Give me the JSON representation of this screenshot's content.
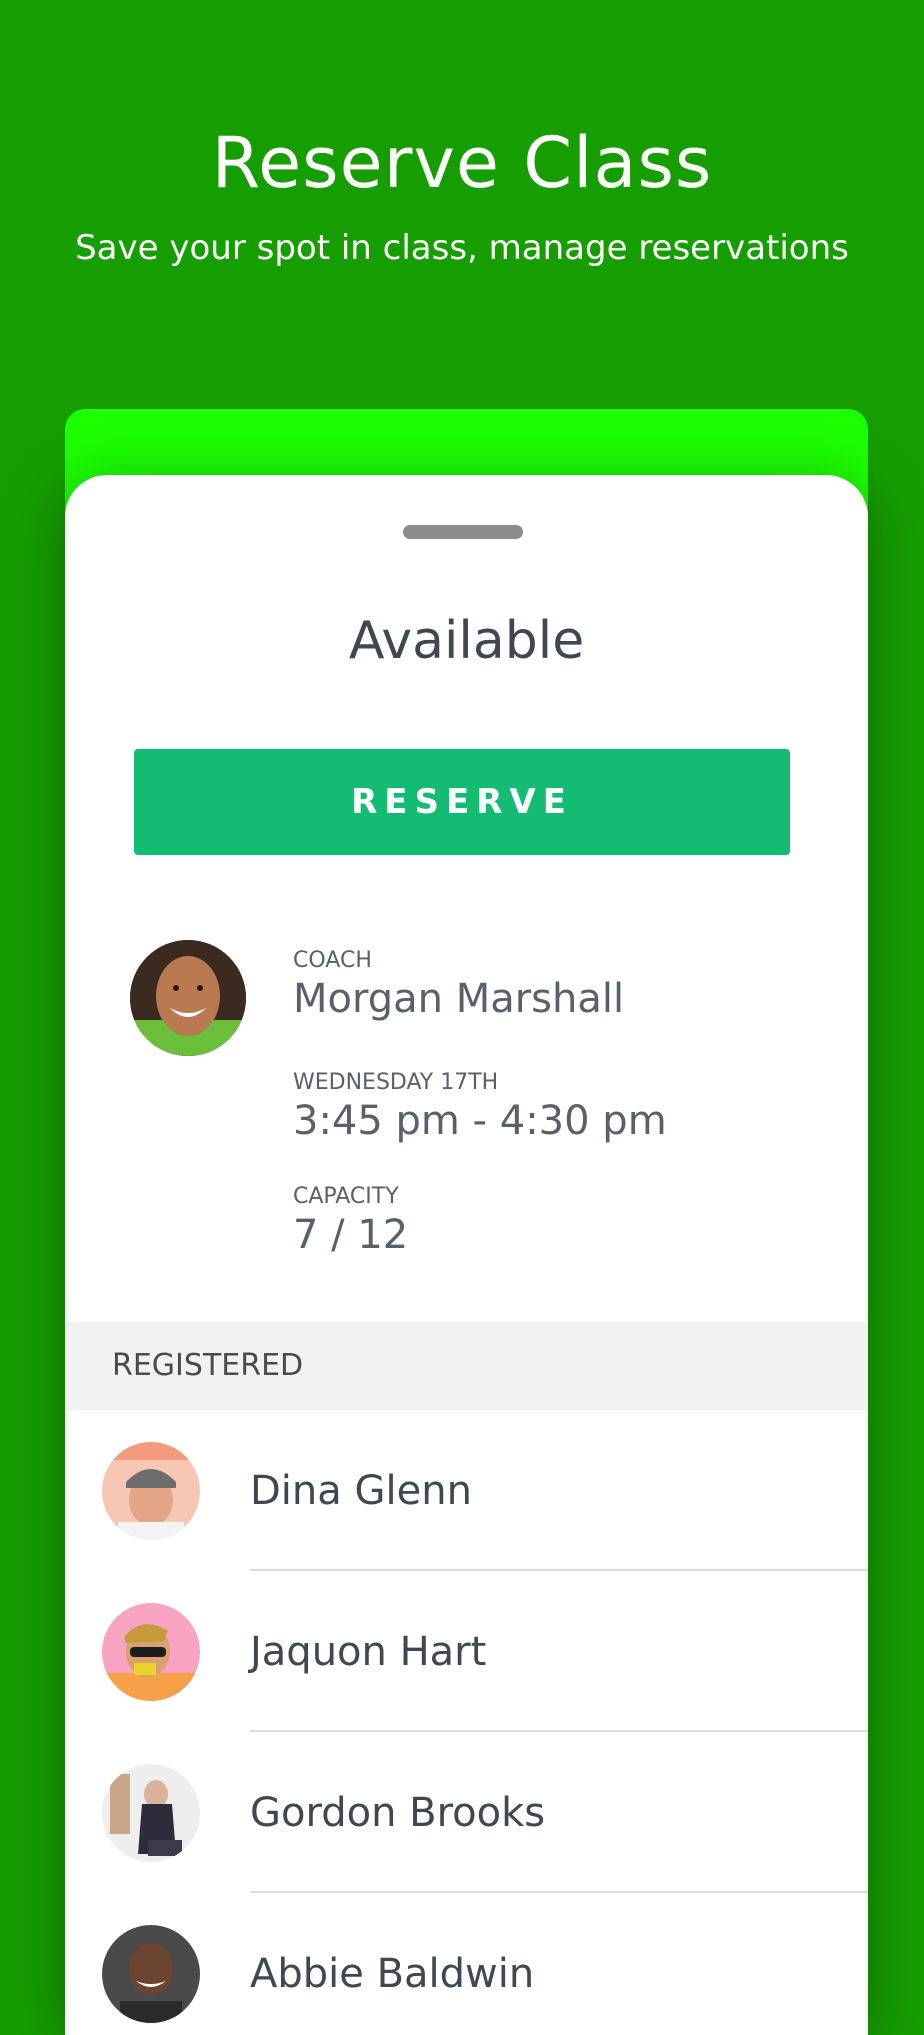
{
  "header": {
    "title": "Reserve Class",
    "subtitle": "Save your spot in class, manage reservations"
  },
  "card": {
    "status": "Available",
    "reserve_label": "RESERVE",
    "coach": {
      "label": "COACH",
      "value": "Morgan Marshall"
    },
    "schedule": {
      "label": "WEDNESDAY 17th",
      "value": "3:45 pm - 4:30 pm"
    },
    "capacity": {
      "label": "CAPACITY",
      "value": "7 / 12"
    }
  },
  "registered": {
    "heading": "REGISTERED",
    "people": [
      {
        "name": "Dina Glenn"
      },
      {
        "name": "Jaquon Hart"
      },
      {
        "name": "Gordon Brooks"
      },
      {
        "name": "Abbie Baldwin"
      }
    ]
  },
  "colors": {
    "background": "#169e00",
    "accent_band": "#1cff00",
    "reserve_button": "#14bb72",
    "text_dark": "#3f4750"
  }
}
